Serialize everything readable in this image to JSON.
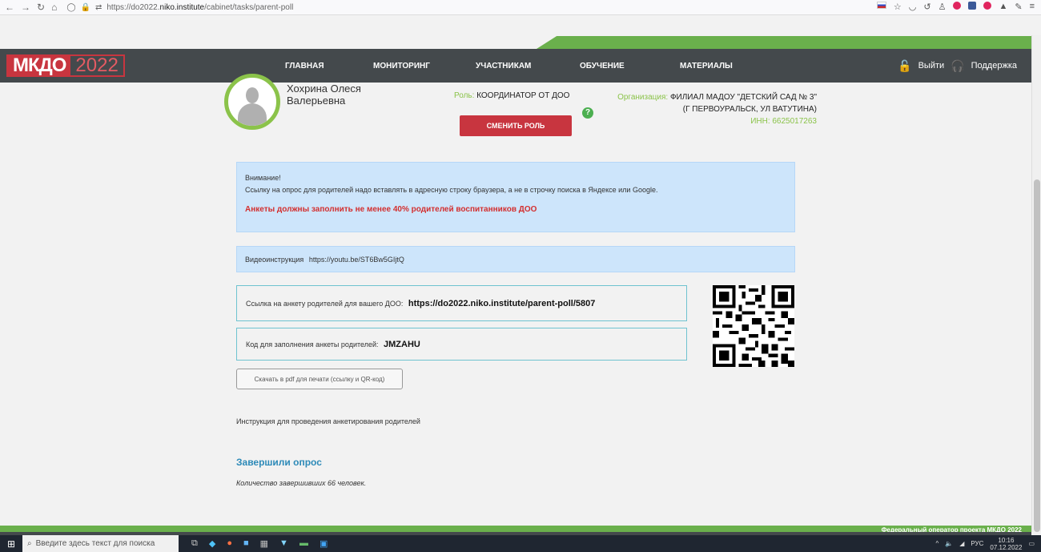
{
  "browser": {
    "url_prefix": "https://do2022.",
    "url_domain": "niko.institute",
    "url_path": "/cabinet/tasks/parent-poll"
  },
  "header": {
    "logo_left": "МКДО",
    "logo_right": "2022",
    "menu": [
      "ГЛАВНАЯ",
      "МОНИТОРИНГ",
      "УЧАСТНИКАМ",
      "ОБУЧЕНИЕ",
      "МАТЕРИАЛЫ"
    ],
    "logout": "Выйти",
    "support": "Поддержка"
  },
  "profile": {
    "name": "Хохрина Олеся Валерьевна",
    "role_label": "Роль:",
    "role": "КООРДИНАТОР ОТ ДОО",
    "change_role": "СМЕНИТЬ РОЛЬ",
    "org_label": "Организация:",
    "org": "ФИЛИАЛ МАДОУ \"ДЕТСКИЙ САД № 3\" (Г ПЕРВОУРАЛЬСК, УЛ ВАТУТИНА)",
    "inn": "ИНН: 6625017263"
  },
  "notice": {
    "title": "Внимание!",
    "text": "Ссылку на опрос для родителей надо вставлять в адресную строку браузера, а не в строчку поиска в Яндексе или Google.",
    "warning": "Анкеты должны заполнить не менее 40% родителей воспитанников ДОО"
  },
  "video": {
    "label": "Видеоинструкция",
    "link": "https://youtu.be/ST6Bw5GIjtQ"
  },
  "poll_link": {
    "label": "Ссылка на анкету родителей для вашего ДОО:",
    "url": "https://do2022.niko.institute/parent-poll/5807"
  },
  "poll_code": {
    "label": "Код для заполнения анкеты родителей:",
    "code": "JMZAHU"
  },
  "pdf_button": "Скачать в pdf для печати (ссылку и QR-код)",
  "instruction_link": "Инструкция для проведения анкетирования родителей",
  "completed": {
    "title": "Завершили опрос",
    "count_text": "Количество завершивших 66 человек."
  },
  "footer": {
    "text": "Федеральный оператор проекта МКДО 2022"
  },
  "taskbar": {
    "search_placeholder": "Введите здесь текст для поиска",
    "lang": "РУС",
    "time": "10:16",
    "date": "07.12.2022"
  }
}
